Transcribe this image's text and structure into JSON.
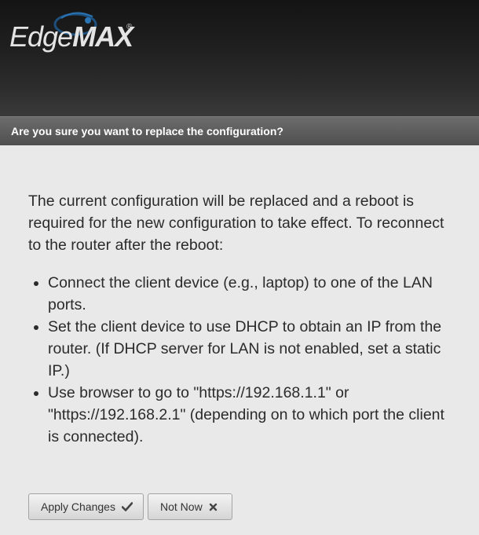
{
  "app": {
    "logo_text_light": "Edge",
    "logo_text_bold": "MAX",
    "logo_tm": "®"
  },
  "dialog": {
    "title": "Are you sure you want to replace the configuration?",
    "intro": "The current configuration will be replaced and a reboot is required for the new configuration to take effect. To reconnect to the router after the reboot:",
    "steps": [
      "Connect the client device (e.g., laptop) to one of the LAN ports.",
      "Set the client device to use DHCP to obtain an IP from the router. (If DHCP server for LAN is not enabled, set a static IP.)",
      "Use browser to go to \"https://192.168.1.1\" or \"https://192.168.2.1\" (depending on to which port the client is connected)."
    ]
  },
  "buttons": {
    "apply_label": "Apply Changes",
    "apply_icon": "checkmark-icon",
    "notnow_label": "Not Now",
    "notnow_icon": "close-icon"
  },
  "colors": {
    "header_bg": "#1f1f1f",
    "titlebar_bg": "#5e5e5e",
    "body_bg": "#e9e9e9",
    "logo_accent": "#1e5b8f"
  }
}
